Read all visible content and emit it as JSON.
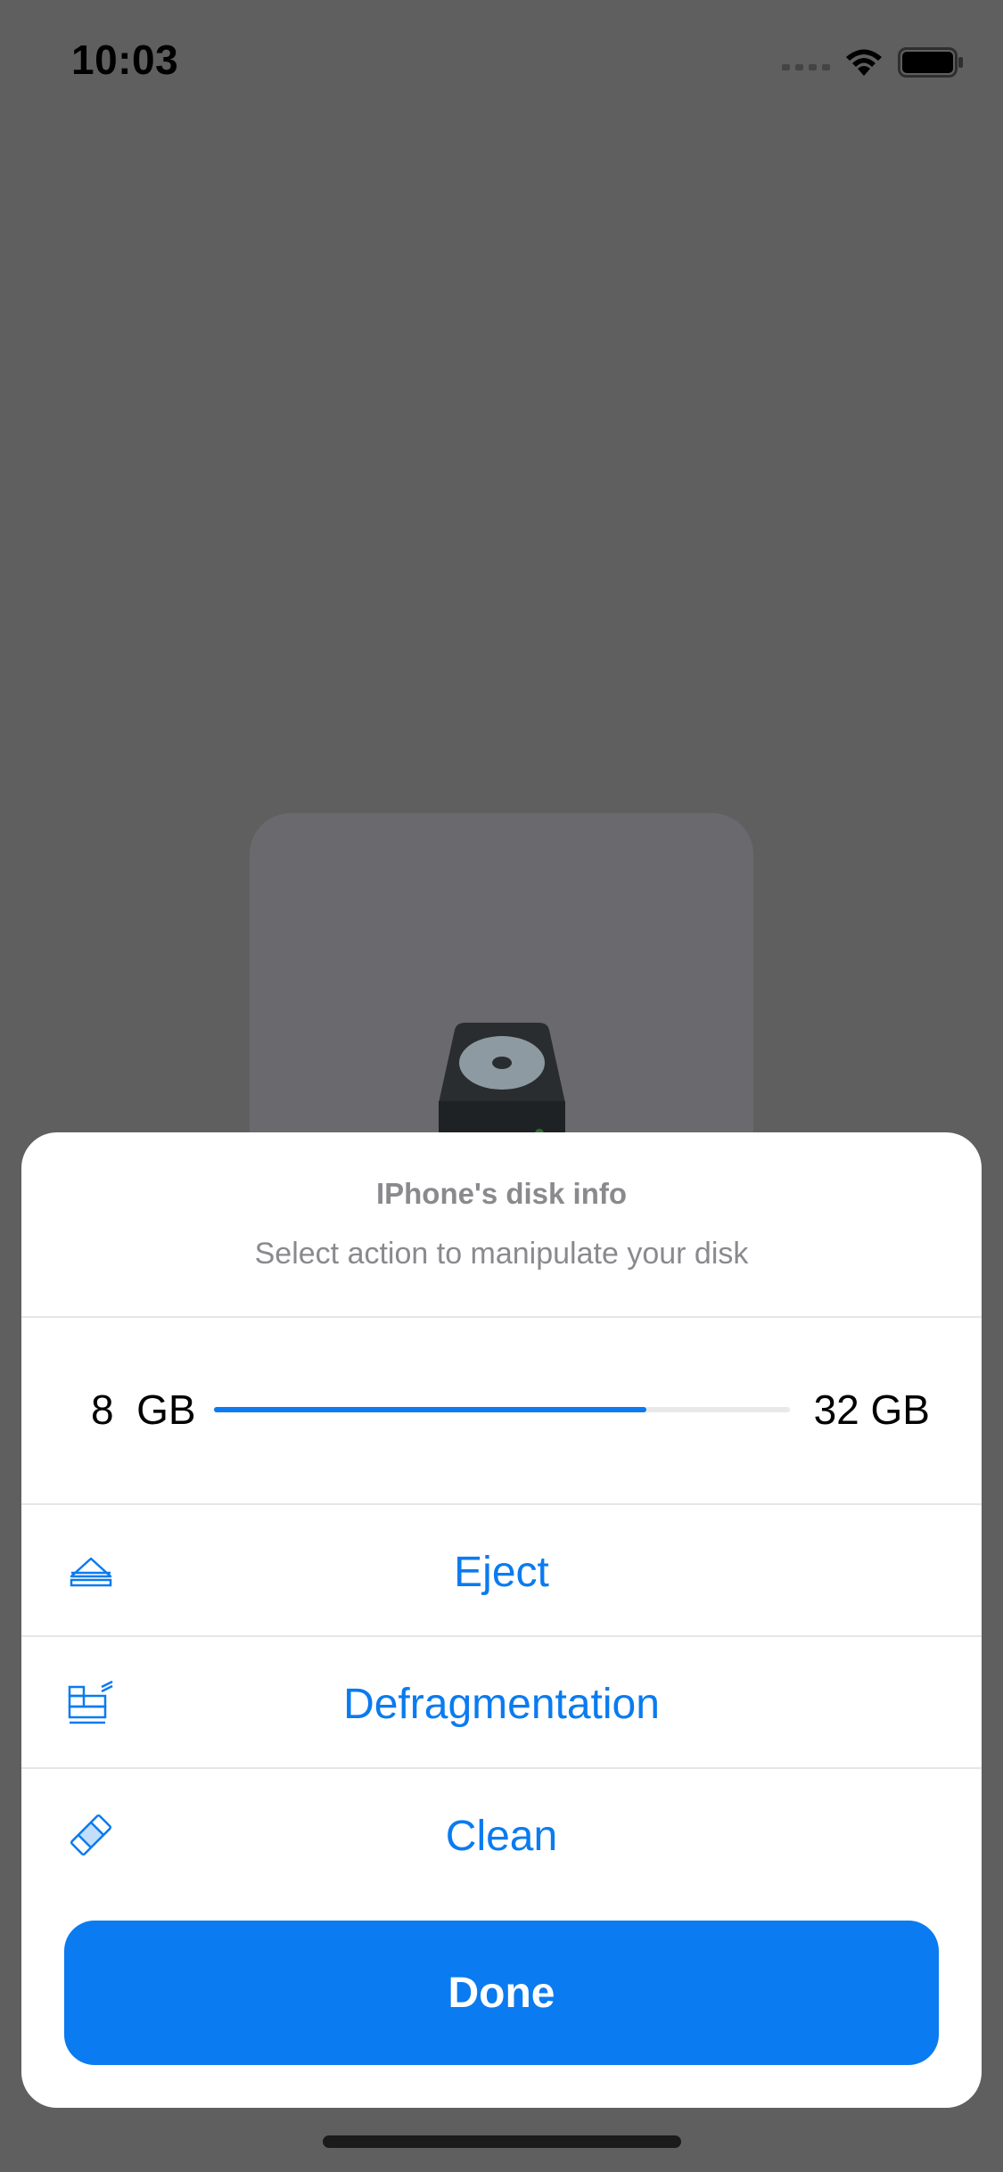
{
  "status_bar": {
    "time": "10:03"
  },
  "sheet": {
    "title": "IPhone's disk info",
    "subtitle": "Select action to manipulate your disk",
    "capacity": {
      "used_label": "8  GB",
      "total_label": "32 GB",
      "fill_fraction": 0.75
    },
    "actions": [
      {
        "label": "Eject",
        "icon": "eject-icon"
      },
      {
        "label": "Defragmentation",
        "icon": "defragmentation-icon"
      },
      {
        "label": "Clean",
        "icon": "eraser-icon"
      }
    ],
    "done_label": "Done"
  },
  "colors": {
    "accent": "#0a7bf0",
    "dim_overlay": "#5f5f5f",
    "secondary_text": "#8a8a8e"
  }
}
